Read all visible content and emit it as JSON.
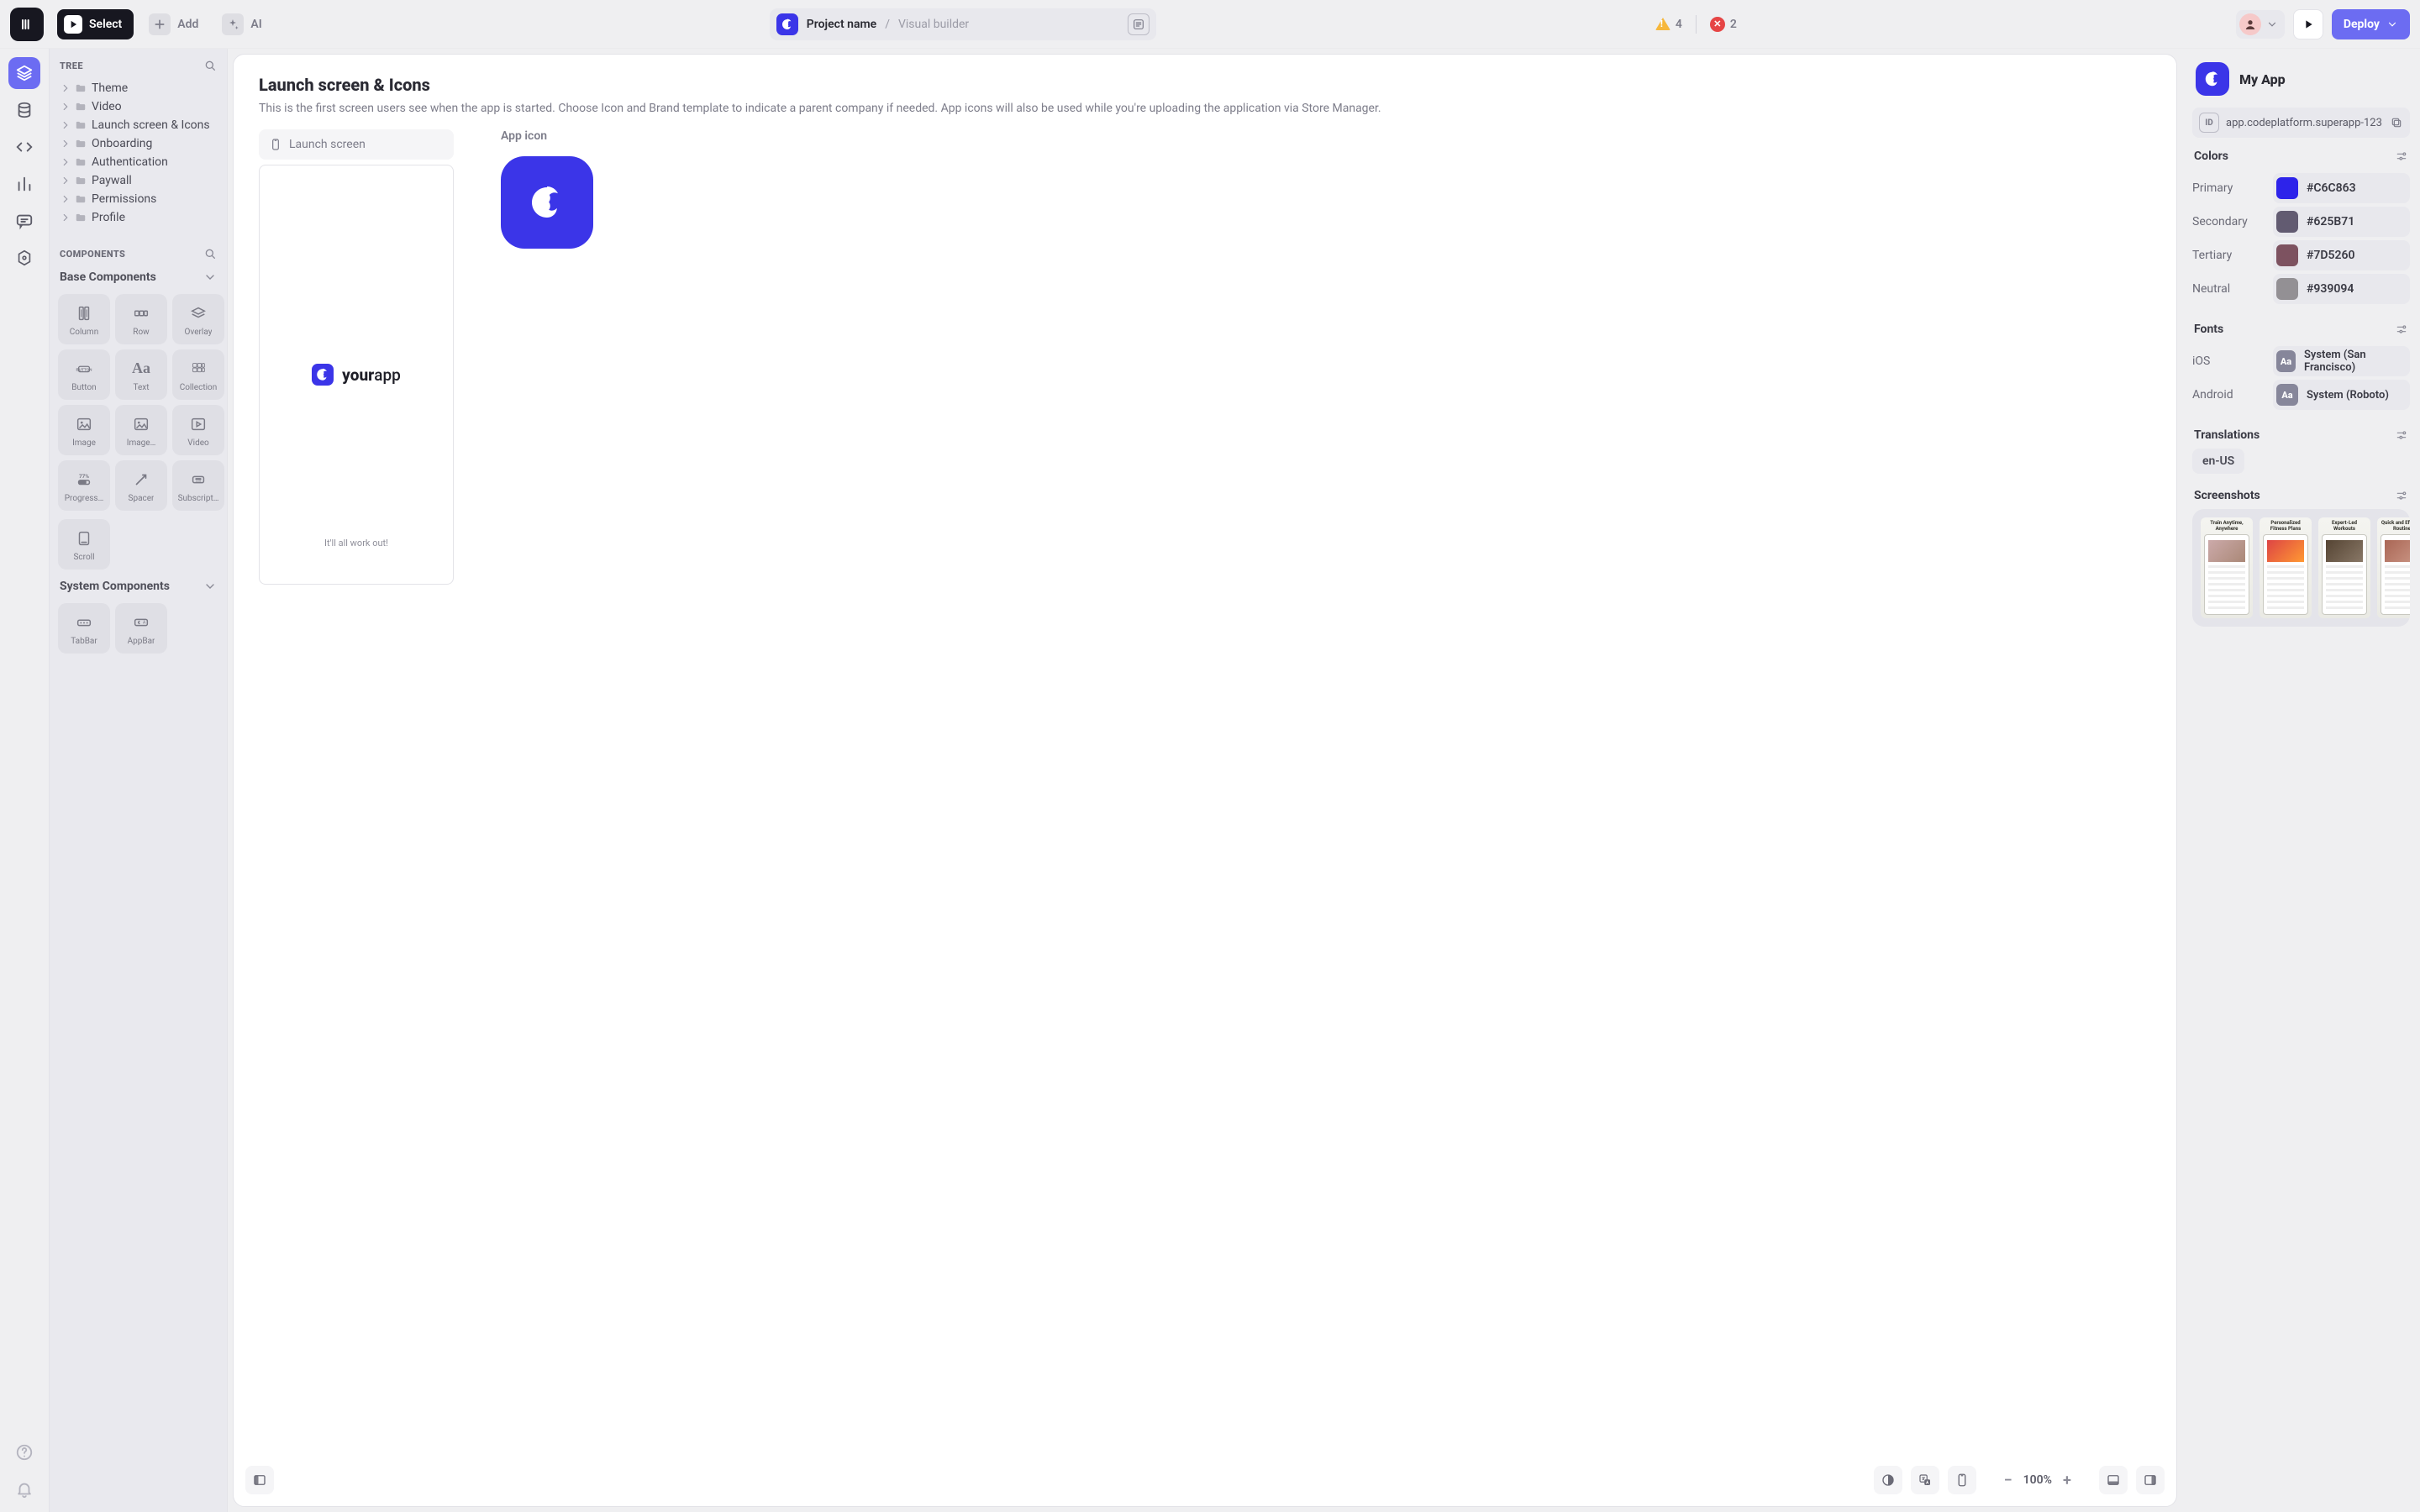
{
  "topbar": {
    "select_label": "Select",
    "add_label": "Add",
    "ai_label": "AI",
    "project_name": "Project name",
    "crumb_separator": "/",
    "crumb_page": "Visual builder",
    "warnings_count": "4",
    "errors_count": "2",
    "deploy_label": "Deploy"
  },
  "tree": {
    "header": "TREE",
    "items": [
      {
        "label": "Theme"
      },
      {
        "label": "Video"
      },
      {
        "label": "Launch screen & Icons"
      },
      {
        "label": "Onboarding"
      },
      {
        "label": "Authentication"
      },
      {
        "label": "Paywall"
      },
      {
        "label": "Permissions"
      },
      {
        "label": "Profile"
      }
    ]
  },
  "components": {
    "header": "COMPONENTS",
    "base_header": "Base Components",
    "system_header": "System Components",
    "base": [
      {
        "label": "Column"
      },
      {
        "label": "Row"
      },
      {
        "label": "Overlay"
      },
      {
        "label": "Button"
      },
      {
        "label": "Text"
      },
      {
        "label": "Collection"
      },
      {
        "label": "Image"
      },
      {
        "label": "Image…"
      },
      {
        "label": "Video"
      },
      {
        "label": "Progress…"
      },
      {
        "label": "Spacer"
      },
      {
        "label": "Subscript…"
      }
    ],
    "scroll": {
      "label": "Scroll"
    },
    "system": [
      {
        "label": "TabBar"
      },
      {
        "label": "AppBar"
      }
    ]
  },
  "canvas": {
    "title": "Launch screen & Icons",
    "description": "This is the first screen users see when the app is started. Choose Icon and Brand template to indicate a parent company if needed. App icons will also be used while you're uploading the application via Store Manager.",
    "chip_label": "Launch screen",
    "brand_bold": "your",
    "brand_light": "app",
    "phone_foot": "It'll all work out!",
    "app_icon_label": "App icon",
    "zoom": "100%"
  },
  "right": {
    "app_name": "My App",
    "app_id": "app.codeplatform.superapp-123",
    "id_badge": "ID",
    "colors_header": "Colors",
    "colors": [
      {
        "name": "Primary",
        "hex": "#C6C863",
        "swatch": "#2d23ea"
      },
      {
        "name": "Secondary",
        "hex": "#625B71",
        "swatch": "#625B71"
      },
      {
        "name": "Tertiary",
        "hex": "#7D5260",
        "swatch": "#7D5260"
      },
      {
        "name": "Neutral",
        "hex": "#939094",
        "swatch": "#939094"
      }
    ],
    "fonts_header": "Fonts",
    "fonts": [
      {
        "platform": "iOS",
        "value": "System (San Francisco)"
      },
      {
        "platform": "Android",
        "value": "System (Roboto)"
      }
    ],
    "fonts_badge": "Aa",
    "translations_header": "Translations",
    "translation_tag": "en-US",
    "screenshots_header": "Screenshots",
    "shots": [
      {
        "title": "Train Anytime, Anywhere"
      },
      {
        "title": "Personalized Fitness Plans"
      },
      {
        "title": "Expert-Led Workouts"
      },
      {
        "title": "Quick and Effective Routines"
      }
    ]
  }
}
